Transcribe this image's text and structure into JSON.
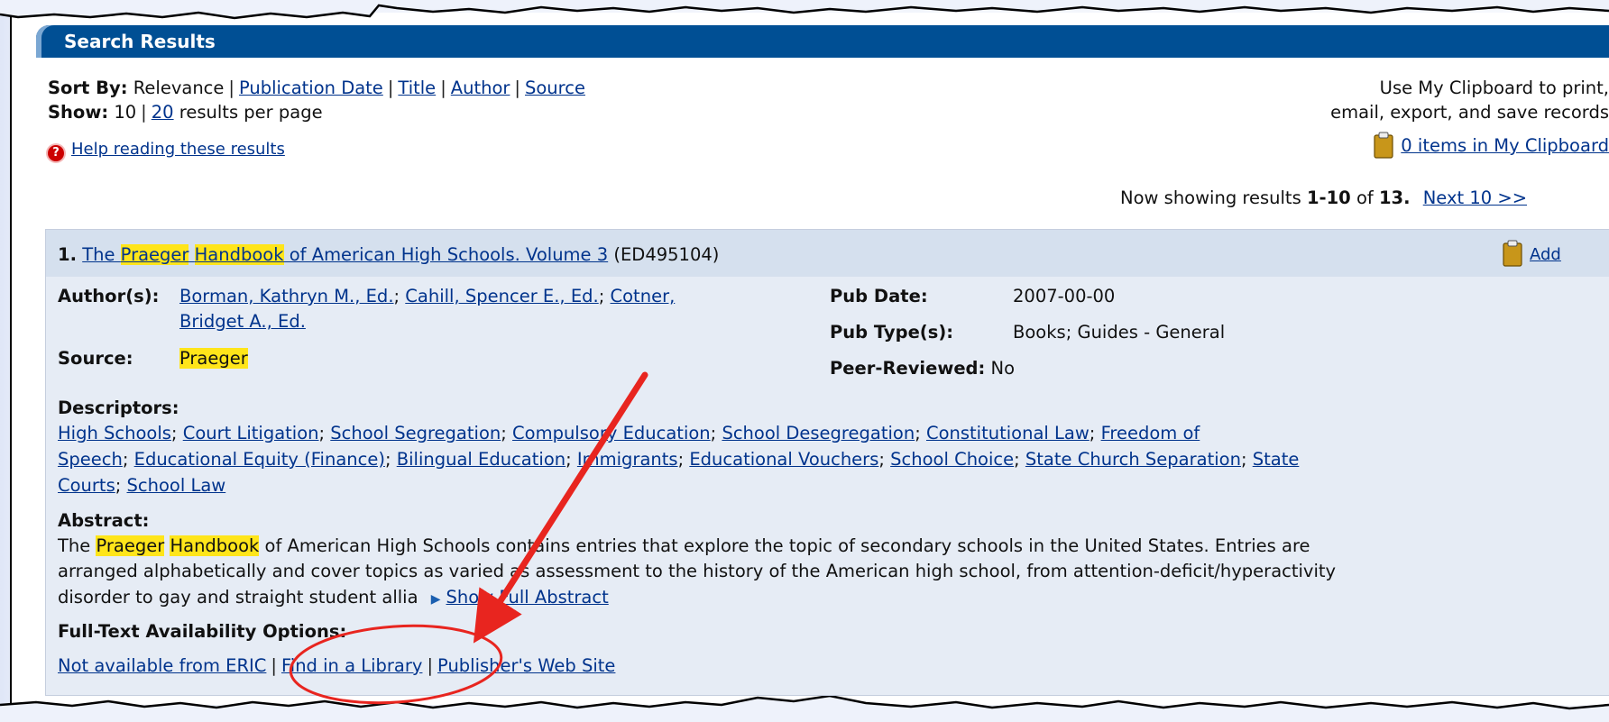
{
  "results_header": {
    "title": "Search Results"
  },
  "sort": {
    "label": "Sort By:",
    "current": "Relevance",
    "options": [
      "Publication Date",
      "Title",
      "Author",
      "Source"
    ]
  },
  "show": {
    "label": "Show:",
    "current": "10",
    "option": "20",
    "suffix": "results per page"
  },
  "help_link": "Help reading these results",
  "clipboard": {
    "info_line1": "Use My Clipboard to print,",
    "info_line2": "email, export, and save records",
    "count_link": "0 items in My Clipboard"
  },
  "pagination": {
    "prefix": "Now showing results",
    "range": "1-10",
    "of": "of",
    "total": "13.",
    "next": "Next 10 >>"
  },
  "record": {
    "number": "1.",
    "title_parts": [
      "The ",
      "Praeger",
      " ",
      "Handbook",
      " of American High Schools. Volume 3"
    ],
    "id": "(ED495104)",
    "add_label": "Add",
    "authors_label": "Author(s):",
    "authors": [
      "Borman, Kathryn M., Ed.",
      "Cahill, Spencer E., Ed.",
      "Cotner,",
      "Bridget A., Ed."
    ],
    "source_label": "Source:",
    "source": "Praeger",
    "pub_date_label": "Pub Date:",
    "pub_date": "2007-00-00",
    "pub_type_label": "Pub Type(s):",
    "pub_type": "Books; Guides - General",
    "peer_label": "Peer-Reviewed:",
    "peer": "No",
    "descriptors_label": "Descriptors:",
    "descriptors": [
      "High Schools",
      "Court Litigation",
      "School Segregation",
      "Compulsory Education",
      "School Desegregation",
      "Constitutional Law",
      "Freedom of",
      "Speech",
      "Educational Equity (Finance)",
      "Bilingual Education",
      "Immigrants",
      "Educational Vouchers",
      "School Choice",
      "State Church Separation",
      "State",
      "Courts",
      "School Law"
    ],
    "abstract_label": "Abstract:",
    "abstract_line1_parts": [
      "The ",
      "Praeger",
      " ",
      "Handbook",
      " of American High Schools contains entries that explore the topic of secondary schools in the United States. Entries are"
    ],
    "abstract_line2": "arranged alphabetically and cover topics as varied as assessment to the history of the American high school, from attention-deficit/hyperactivity",
    "abstract_line3": "disorder to gay and straight student allia",
    "show_full": "Show Full Abstract",
    "fulltext_label": "Full-Text Availability Options:",
    "fulltext_links": [
      "Not available from ERIC",
      "Find in a Library",
      "Publisher's Web Site"
    ]
  },
  "annotation": {
    "arrow_color": "#e8251f",
    "circle_color": "#e8251f"
  }
}
